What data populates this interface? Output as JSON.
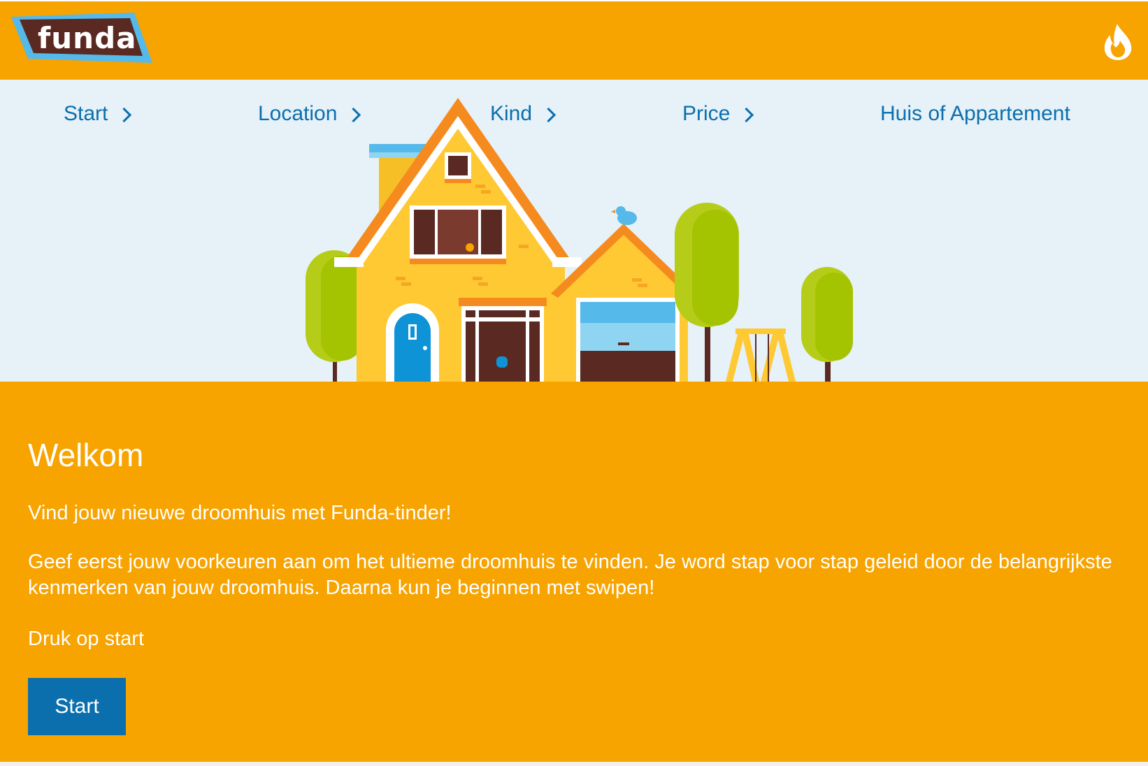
{
  "header": {
    "logo_text": "funda",
    "logo_icon": "funda-logo",
    "hot_icon": "flame-icon"
  },
  "steps": [
    {
      "label": "Start"
    },
    {
      "label": "Location"
    },
    {
      "label": "Kind"
    },
    {
      "label": "Price"
    },
    {
      "label": "Huis of Appartement"
    }
  ],
  "main": {
    "title": "Welkom",
    "intro": "Vind jouw nieuwe droomhuis met Funda-tinder!",
    "description": "Geef eerst jouw voorkeuren aan om het ultieme droomhuis te vinden. Je word stap voor stap geleid door de belangrijkste kenmerken van jouw droomhuis. Daarna kun je beginnen met swipen!",
    "instruction": "Druk op start",
    "start_button": "Start"
  },
  "colors": {
    "brand_orange": "#f7a300",
    "link_blue": "#0b6fae",
    "hero_sky": "#e6f1f8"
  }
}
